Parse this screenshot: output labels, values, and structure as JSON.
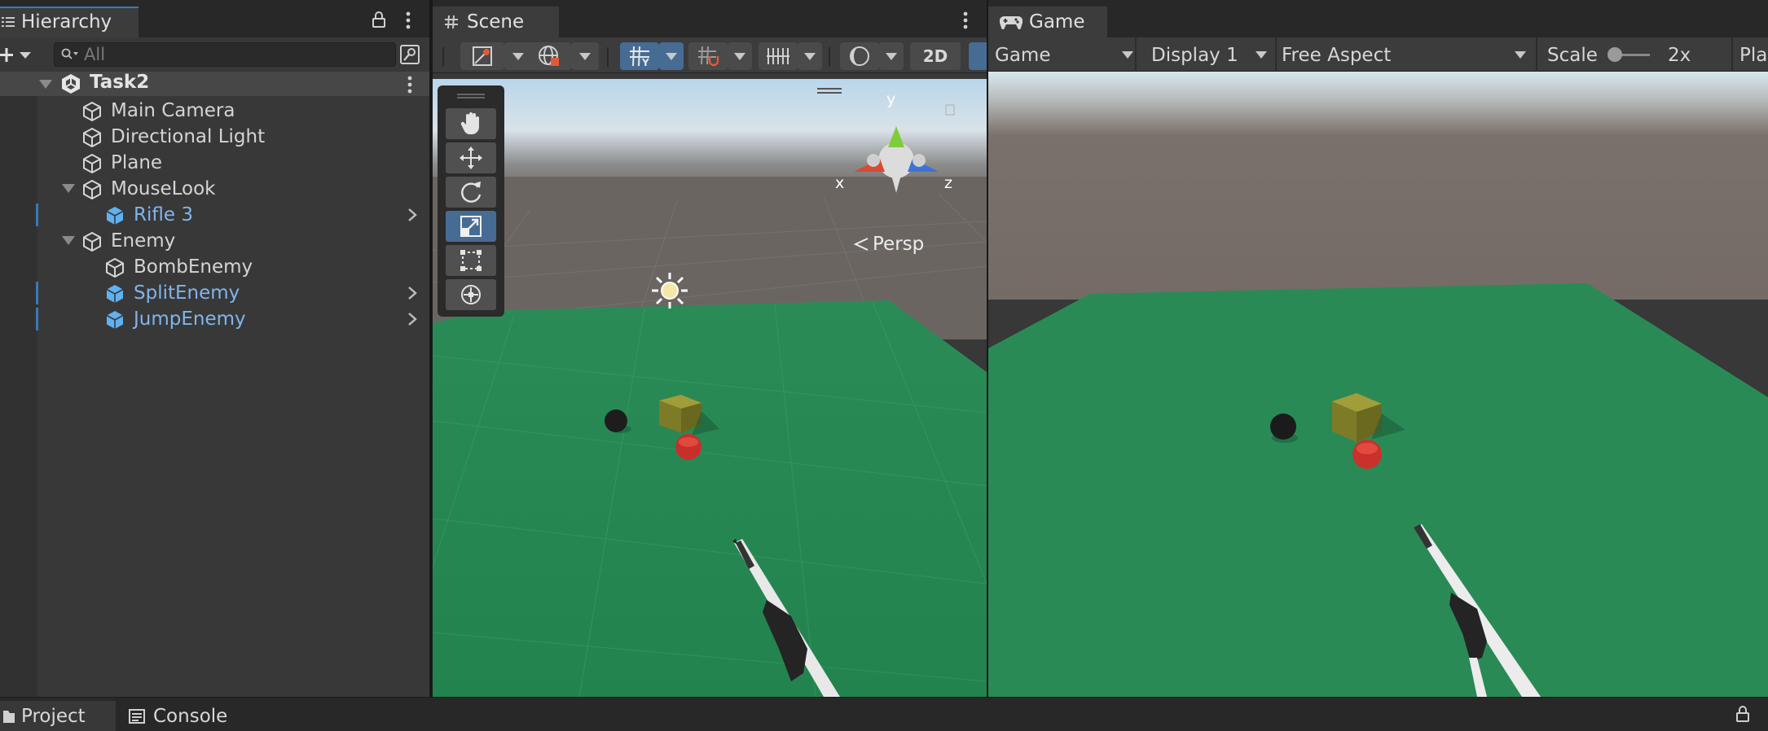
{
  "hierarchy": {
    "tab_label": "Hierarchy",
    "search_placeholder": "All",
    "scene_name": "Task2",
    "items": [
      {
        "label": "Main Camera"
      },
      {
        "label": "Directional Light"
      },
      {
        "label": "Plane"
      },
      {
        "label": "MouseLook"
      },
      {
        "label": "Rifle 3"
      },
      {
        "label": "Enemy"
      },
      {
        "label": "BombEnemy"
      },
      {
        "label": "SplitEnemy"
      },
      {
        "label": "JumpEnemy"
      }
    ]
  },
  "scene": {
    "tab_label": "Scene",
    "mode_2d": "2D",
    "gizmo": {
      "x": "x",
      "y": "y",
      "z": "z",
      "projection": "Persp"
    }
  },
  "game": {
    "tab_label": "Game",
    "view_select": "Game",
    "display_select": "Display 1",
    "aspect_select": "Free Aspect",
    "scale_label": "Scale",
    "scale_value": "2x",
    "play_label": "Pla"
  },
  "bottom_tabs": {
    "project_label": "Project",
    "console_label": "Console"
  },
  "colors": {
    "accent": "#3a79bb",
    "prefab_text": "#7fb5ec",
    "ground_green": "#2a8a55",
    "editor_bg": "#383838"
  }
}
